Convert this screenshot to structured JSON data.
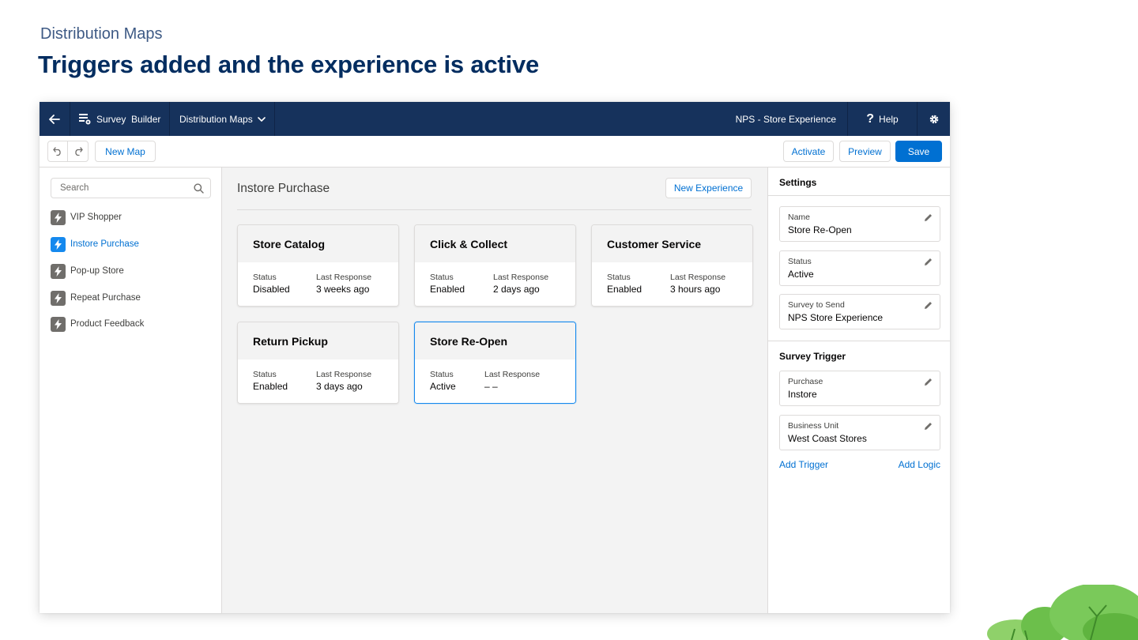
{
  "slide": {
    "kicker": "Distribution Maps",
    "title": "Triggers added and the experience is active"
  },
  "nav": {
    "back_icon": "arrow-left-icon",
    "survey_builder_label": "Survey  Builder",
    "distribution_maps_label": "Distribution Maps",
    "current_survey": "NPS - Store Experience",
    "help_label": "Help"
  },
  "toolbar": {
    "new_map_label": "New Map",
    "activate_label": "Activate",
    "preview_label": "Preview",
    "save_label": "Save"
  },
  "sidebar": {
    "search_placeholder": "Search",
    "items": [
      {
        "label": "VIP Shopper",
        "active": false
      },
      {
        "label": "Instore Purchase",
        "active": true
      },
      {
        "label": "Pop-up Store",
        "active": false
      },
      {
        "label": "Repeat Purchase",
        "active": false
      },
      {
        "label": "Product Feedback",
        "active": false
      }
    ]
  },
  "main": {
    "title": "Instore Purchase",
    "new_experience_label": "New Experience",
    "status_label": "Status",
    "last_response_label": "Last Response",
    "cards": [
      {
        "title": "Store Catalog",
        "status": "Disabled",
        "last_response": "3 weeks ago"
      },
      {
        "title": "Click & Collect",
        "status": "Enabled",
        "last_response": "2 days ago"
      },
      {
        "title": "Customer Service",
        "status": "Enabled",
        "last_response": "3 hours ago"
      },
      {
        "title": "Return Pickup",
        "status": "Enabled",
        "last_response": "3 days ago"
      },
      {
        "title": "Store Re-Open",
        "status": "Active",
        "last_response": "– –",
        "selected": true
      }
    ]
  },
  "settings": {
    "heading": "Settings",
    "fields": [
      {
        "label": "Name",
        "value": "Store Re-Open"
      },
      {
        "label": "Status",
        "value": "Active"
      },
      {
        "label": "Survey to Send",
        "value": "NPS Store Experience"
      }
    ],
    "trigger_heading": "Survey Trigger",
    "triggers": [
      {
        "label": "Purchase",
        "value": "Instore"
      },
      {
        "label": "Business Unit",
        "value": "West Coast Stores"
      }
    ],
    "add_trigger_label": "Add Trigger",
    "add_logic_label": "Add Logic"
  },
  "colors": {
    "nav_bg": "#16325c",
    "brand_blue": "#0070d2",
    "title_navy": "#032d60",
    "selected_border": "#1589ee"
  }
}
